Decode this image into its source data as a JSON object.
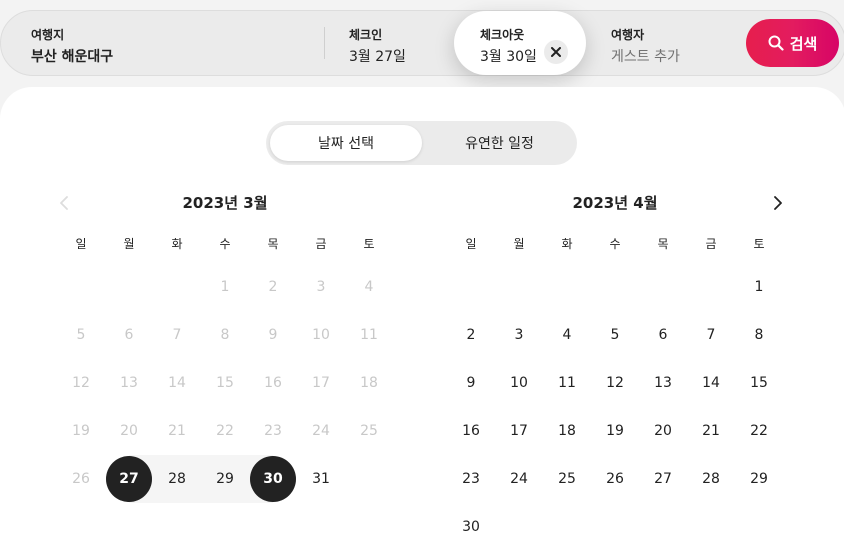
{
  "search": {
    "destination_label": "여행지",
    "destination_value": "부산 해운대구",
    "checkin_label": "체크인",
    "checkin_value": "3월 27일",
    "checkout_label": "체크아웃",
    "checkout_value": "3월 30일",
    "guests_label": "여행자",
    "guests_placeholder": "게스트 추가",
    "search_button": "검색",
    "clear_icon": "close-icon",
    "search_icon": "search-icon",
    "accent_color": "#e31c5f"
  },
  "date_mode": {
    "options": [
      "날짜 선택",
      "유연한 일정"
    ],
    "active": "날짜 선택"
  },
  "weekdays": [
    "일",
    "월",
    "화",
    "수",
    "목",
    "금",
    "토"
  ],
  "calendars": [
    {
      "title": "2023년 3월",
      "days": [
        "",
        "",
        "",
        "1",
        "2",
        "3",
        "4",
        "5",
        "6",
        "7",
        "8",
        "9",
        "10",
        "11",
        "12",
        "13",
        "14",
        "15",
        "16",
        "17",
        "18",
        "19",
        "20",
        "21",
        "22",
        "23",
        "24",
        "25",
        "26",
        "27",
        "28",
        "29",
        "30",
        "31"
      ],
      "past_until": 26,
      "selected_start": 27,
      "selected_end": 30
    },
    {
      "title": "2023년 4월",
      "days": [
        "",
        "",
        "",
        "",
        "",
        "",
        "1",
        "2",
        "3",
        "4",
        "5",
        "6",
        "7",
        "8",
        "9",
        "10",
        "11",
        "12",
        "13",
        "14",
        "15",
        "16",
        "17",
        "18",
        "19",
        "20",
        "21",
        "22",
        "23",
        "24",
        "25",
        "26",
        "27",
        "28",
        "29",
        "30"
      ]
    }
  ]
}
